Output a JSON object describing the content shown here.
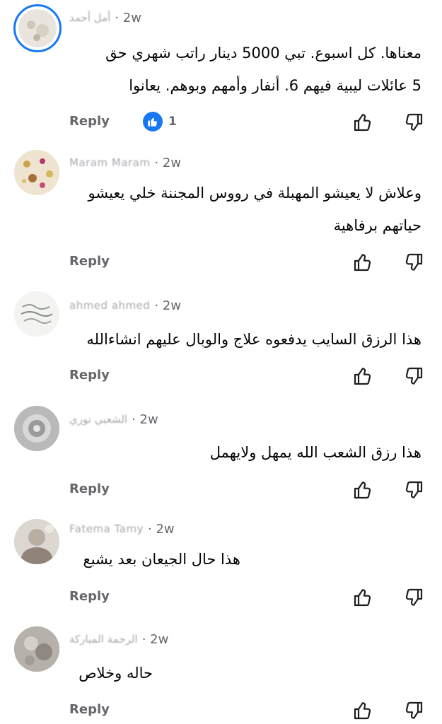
{
  "colors": {
    "text": "#050505",
    "muted": "#65676b",
    "reaction_blue": "#1877f2",
    "background": "#ffffff"
  },
  "comments": [
    {
      "author": "أمل أحمد",
      "time": "· 2w",
      "lines": [
        "معناها. كل اسبوع. تبي 5000 دينار راتب شهري حق",
        "5 عائلات ليبية فيهم 6. أنفار وأمهم وبوهم. يعانوا"
      ],
      "reply_label": "Reply",
      "reaction_icon": "thumbs-up-icon",
      "reaction_count": "1"
    },
    {
      "author": "Maram Maram",
      "time": "· 2w",
      "lines": [
        "وعلاش لا يعيشو المهبلة في رووس المجننة خلي يعيشو",
        "حياتهم برفاهية"
      ],
      "reply_label": "Reply"
    },
    {
      "author": "ahmed ahmed",
      "time": "· 2w",
      "lines": [
        "هذا الرزق السايب يدفعوه علاج والوبال عليهم انشاءالله"
      ],
      "reply_label": "Reply"
    },
    {
      "author": "الشعبي نوري",
      "time": "· 2w",
      "lines": [
        "هذا رزق الشعب الله يمهل ولايهمل"
      ],
      "reply_label": "Reply"
    },
    {
      "author": "Fatema Tamy",
      "time": "· 2w",
      "lines": [
        "هذا حال الجيعان بعد يشبع"
      ],
      "reply_label": "Reply"
    },
    {
      "author": "الرحمة المباركة",
      "time": "· 2w",
      "lines": [
        "حاله وخلاص"
      ],
      "reply_label": "Reply"
    }
  ]
}
